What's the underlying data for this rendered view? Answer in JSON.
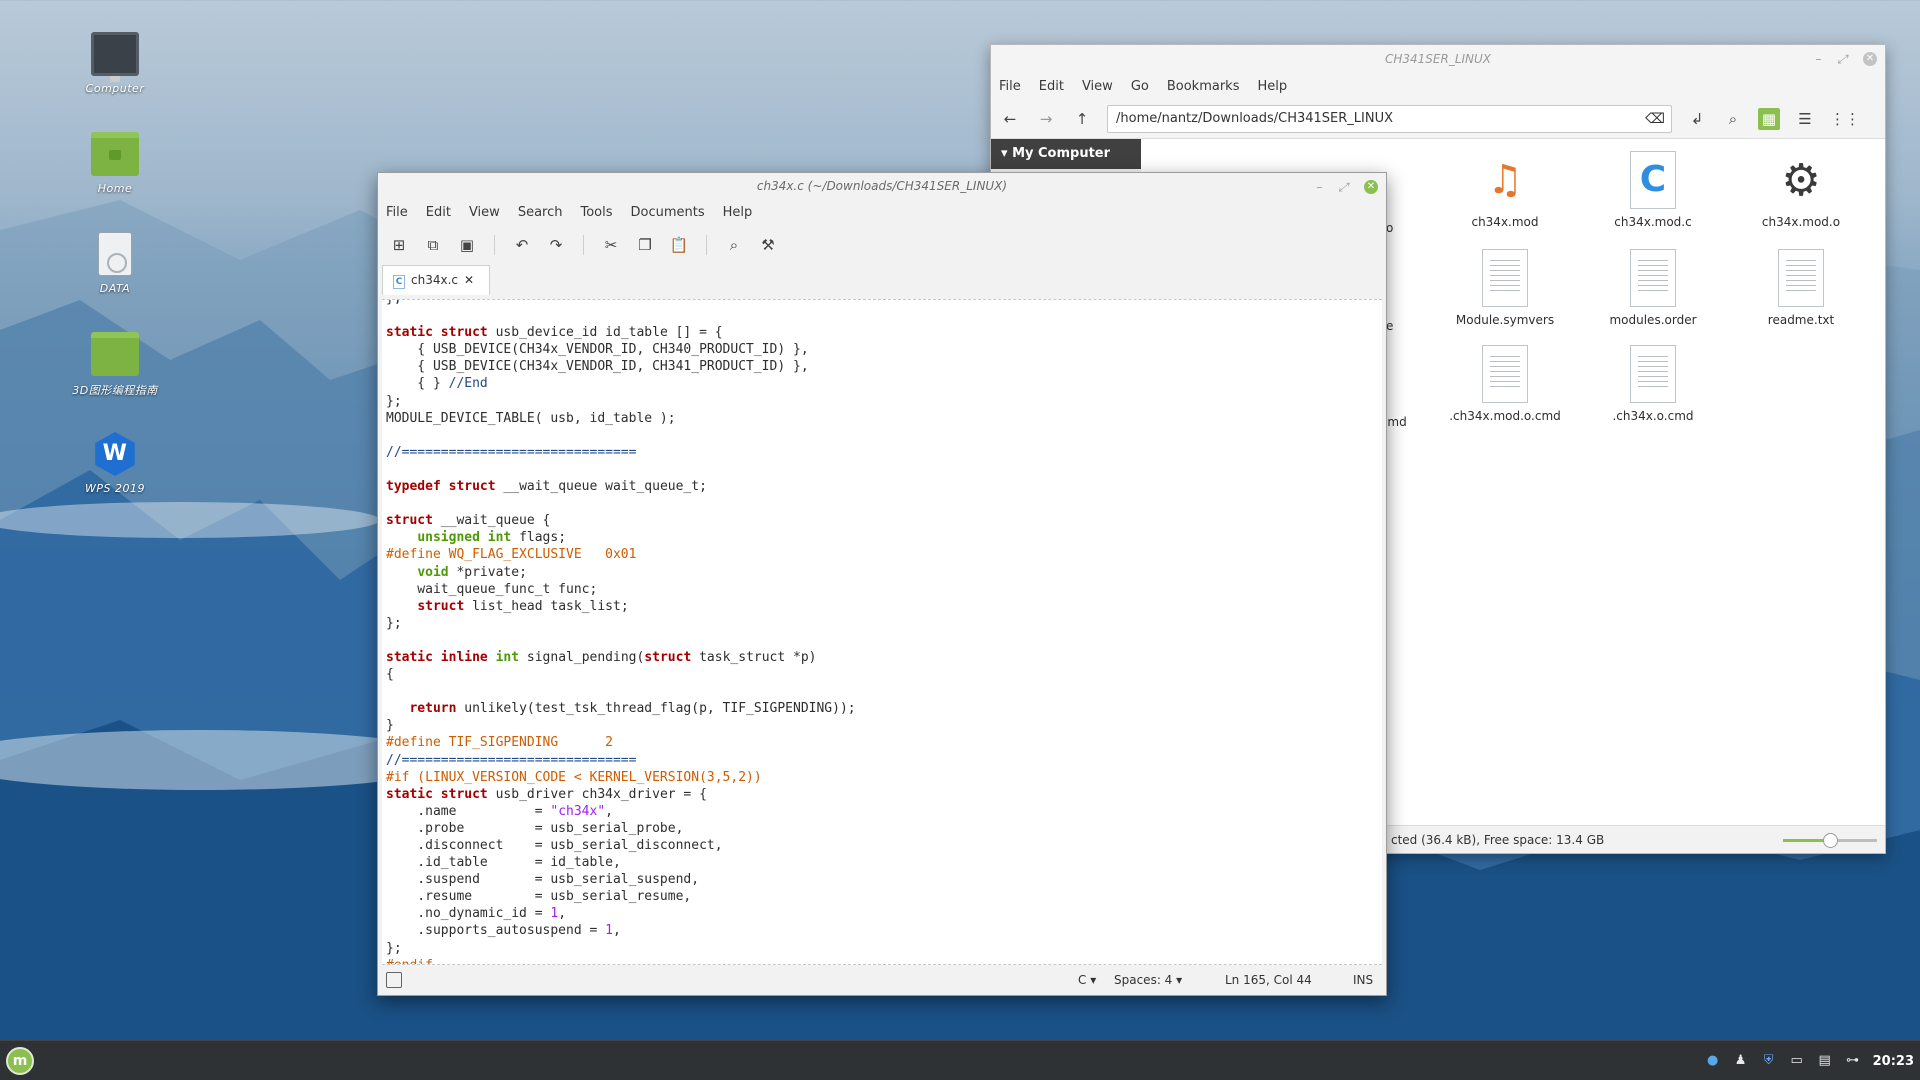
{
  "desktop": {
    "icons": [
      {
        "label": "Computer"
      },
      {
        "label": "Home"
      },
      {
        "label": "DATA"
      },
      {
        "label": "3D图形编程指南"
      },
      {
        "label": "WPS 2019"
      }
    ]
  },
  "file_manager": {
    "title": "CH341SER_LINUX",
    "menu": [
      "File",
      "Edit",
      "View",
      "Go",
      "Bookmarks",
      "Help"
    ],
    "path": "/home/nantz/Downloads/CH341SER_LINUX",
    "sidebar_header": "My Computer",
    "partial_labels": [
      "o",
      "e",
      ".cmd"
    ],
    "files": [
      {
        "name": "ch34x.mod",
        "icon": "music-icon"
      },
      {
        "name": "ch34x.mod.c",
        "icon": "c-source-icon"
      },
      {
        "name": "ch34x.mod.o",
        "icon": "gear-icon"
      },
      {
        "name": "Module.symvers",
        "icon": "document-icon"
      },
      {
        "name": "modules.order",
        "icon": "document-icon"
      },
      {
        "name": "readme.txt",
        "icon": "document-icon"
      },
      {
        "name": ".ch34x.mod.o.cmd",
        "icon": "document-icon"
      },
      {
        "name": ".ch34x.o.cmd",
        "icon": "document-icon"
      }
    ],
    "status": "cted (36.4 kB), Free space: 13.4 GB",
    "zoom_fraction": 0.5
  },
  "editor": {
    "title": "ch34x.c (~/Downloads/CH341SER_LINUX)",
    "menu": [
      "File",
      "Edit",
      "View",
      "Search",
      "Tools",
      "Documents",
      "Help"
    ],
    "tab_label": "ch34x.c",
    "tab_close": "✕",
    "status": {
      "language": "C",
      "spaces": "Spaces: 4",
      "position": "Ln 165, Col 44",
      "mode": "INS"
    }
  },
  "taskbar": {
    "clock": "20:23"
  }
}
